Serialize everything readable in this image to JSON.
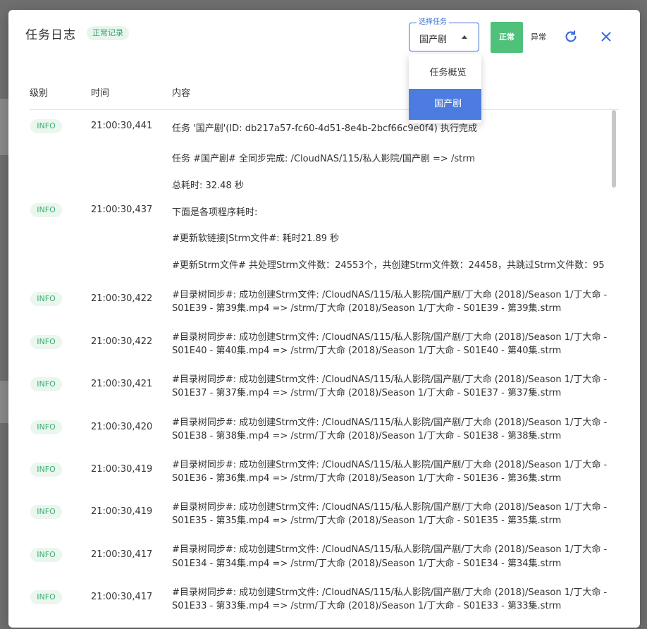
{
  "dialog": {
    "title": "任务日志",
    "status_chip": "正常记录",
    "select_label": "选择任务",
    "select_value": "国产剧",
    "btn_normal": "正常",
    "btn_abnormal": "异常",
    "dropdown": [
      "任务概览",
      "国产剧"
    ]
  },
  "table": {
    "headers": [
      "级别",
      "时间",
      "内容"
    ],
    "rows": [
      {
        "level": "INFO",
        "time": "21:00:30,441",
        "lines": [
          "任务 '国产剧'(ID: db217a57-fc60-4d51-8e4b-2bcf66c9e0f4) 执行完成",
          "任务 #国产剧# 全同步完成: /CloudNAS/115/私人影院/国产剧 => /strm",
          "总耗时: 32.48 秒"
        ]
      },
      {
        "level": "INFO",
        "time": "21:00:30,437",
        "lines": [
          "下面是各项程序耗时:",
          "#更新软链接|Strm文件#: 耗时21.89 秒",
          "#更新Strm文件# 共处理Strm文件数：24553个，共创建Strm文件数：24458，共跳过Strm文件数：95"
        ]
      },
      {
        "level": "INFO",
        "time": "21:00:30,422",
        "lines": [
          "#目录树同步#: 成功创建Strm文件: /CloudNAS/115/私人影院/国产剧/丁大命 (2018)/Season 1/丁大命 -",
          "S01E39 - 第39集.mp4 => /strm/丁大命 (2018)/Season 1/丁大命 - S01E39 - 第39集.strm"
        ]
      },
      {
        "level": "INFO",
        "time": "21:00:30,422",
        "lines": [
          "#目录树同步#: 成功创建Strm文件: /CloudNAS/115/私人影院/国产剧/丁大命 (2018)/Season 1/丁大命 -",
          "S01E40 - 第40集.mp4 => /strm/丁大命 (2018)/Season 1/丁大命 - S01E40 - 第40集.strm"
        ]
      },
      {
        "level": "INFO",
        "time": "21:00:30,421",
        "lines": [
          "#目录树同步#: 成功创建Strm文件: /CloudNAS/115/私人影院/国产剧/丁大命 (2018)/Season 1/丁大命 -",
          "S01E37 - 第37集.mp4 => /strm/丁大命 (2018)/Season 1/丁大命 - S01E37 - 第37集.strm"
        ]
      },
      {
        "level": "INFO",
        "time": "21:00:30,420",
        "lines": [
          "#目录树同步#: 成功创建Strm文件: /CloudNAS/115/私人影院/国产剧/丁大命 (2018)/Season 1/丁大命 -",
          "S01E38 - 第38集.mp4 => /strm/丁大命 (2018)/Season 1/丁大命 - S01E38 - 第38集.strm"
        ]
      },
      {
        "level": "INFO",
        "time": "21:00:30,419",
        "lines": [
          "#目录树同步#: 成功创建Strm文件: /CloudNAS/115/私人影院/国产剧/丁大命 (2018)/Season 1/丁大命 -",
          "S01E36 - 第36集.mp4 => /strm/丁大命 (2018)/Season 1/丁大命 - S01E36 - 第36集.strm"
        ]
      },
      {
        "level": "INFO",
        "time": "21:00:30,419",
        "lines": [
          "#目录树同步#: 成功创建Strm文件: /CloudNAS/115/私人影院/国产剧/丁大命 (2018)/Season 1/丁大命 -",
          "S01E35 - 第35集.mp4 => /strm/丁大命 (2018)/Season 1/丁大命 - S01E35 - 第35集.strm"
        ]
      },
      {
        "level": "INFO",
        "time": "21:00:30,417",
        "lines": [
          "#目录树同步#: 成功创建Strm文件: /CloudNAS/115/私人影院/国产剧/丁大命 (2018)/Season 1/丁大命 -",
          "S01E34 - 第34集.mp4 => /strm/丁大命 (2018)/Season 1/丁大命 - S01E34 - 第34集.strm"
        ]
      },
      {
        "level": "INFO",
        "time": "21:00:30,417",
        "lines": [
          "#目录树同步#: 成功创建Strm文件: /CloudNAS/115/私人影院/国产剧/丁大命 (2018)/Season 1/丁大命 -",
          "S01E33 - 第33集.mp4 => /strm/丁大命 (2018)/Season 1/丁大命 - S01E33 - 第33集.strm"
        ]
      }
    ]
  }
}
